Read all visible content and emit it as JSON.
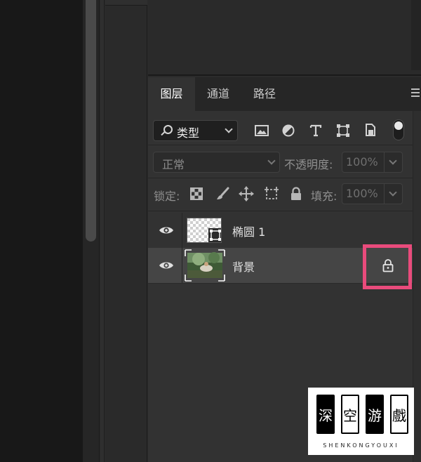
{
  "tabs": [
    {
      "label": "图层",
      "active": true
    },
    {
      "label": "通道",
      "active": false
    },
    {
      "label": "路径",
      "active": false
    }
  ],
  "filter": {
    "selected": "类型"
  },
  "filter_icons": [
    "image-filter-icon",
    "adjustment-filter-icon",
    "type-filter-icon",
    "shape-filter-icon",
    "smart-object-filter-icon"
  ],
  "blend": {
    "mode": "正常",
    "opacity_label": "不透明度:",
    "opacity_value": "100%"
  },
  "lock": {
    "label": "锁定:",
    "fill_label": "填充:",
    "fill_value": "100%"
  },
  "layers": [
    {
      "name": "椭圆 1",
      "visible": true,
      "type": "shape",
      "selected": false,
      "locked": false
    },
    {
      "name": "背景",
      "visible": true,
      "type": "image",
      "selected": true,
      "locked": true
    }
  ],
  "colors": {
    "highlight": "#e94b7c",
    "panel": "#323232",
    "selected_row": "#454545"
  },
  "watermark": {
    "chars": [
      "深",
      "空",
      "游",
      "戲"
    ],
    "pinyin": "SHENKONGYOUXI"
  }
}
